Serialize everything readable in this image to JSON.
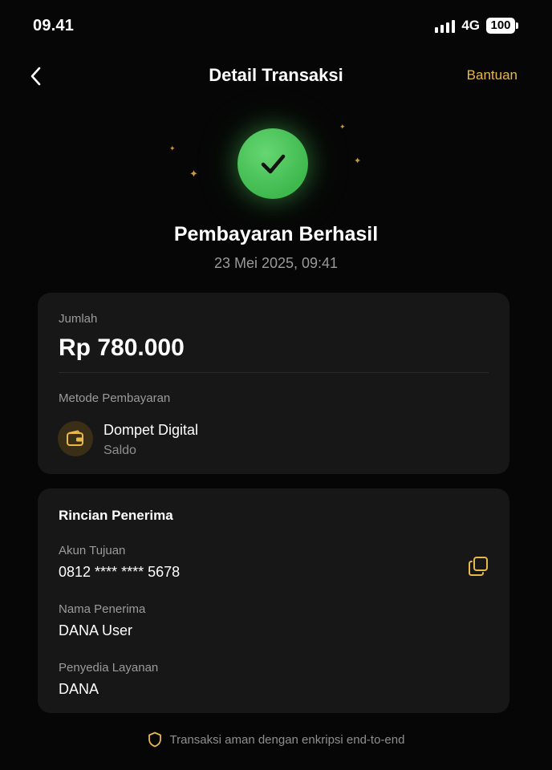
{
  "status_bar": {
    "time": "09.41",
    "network": "4G",
    "battery": "100"
  },
  "header": {
    "title": "Detail Transaksi",
    "help_label": "Bantuan"
  },
  "hero": {
    "title": "Pembayaran Berhasil",
    "date": "23 Mei 2025, 09:41"
  },
  "amount_card": {
    "amount_label": "Jumlah",
    "amount": "Rp 780.000",
    "method_label": "Metode Pembayaran",
    "method_name": "Dompet Digital",
    "method_sub": "Saldo"
  },
  "recipient_card": {
    "title": "Rincian Penerima",
    "account_label": "Akun Tujuan",
    "account_value": "0812 **** **** 5678",
    "name_label": "Nama Penerima",
    "name_value": "DANA User",
    "provider_label": "Penyedia Layanan",
    "provider_value": "DANA"
  },
  "footer": {
    "note": "Transaksi aman dengan enkripsi end-to-end"
  },
  "colors": {
    "accent": "#e8b84a",
    "success": "#4cc25a",
    "card": "#171717",
    "background": "#060606"
  },
  "icons": [
    "signal-icon",
    "battery-icon",
    "back-icon",
    "check-icon",
    "sparkle-icon",
    "wallet-icon",
    "copy-icon",
    "shield-icon"
  ]
}
